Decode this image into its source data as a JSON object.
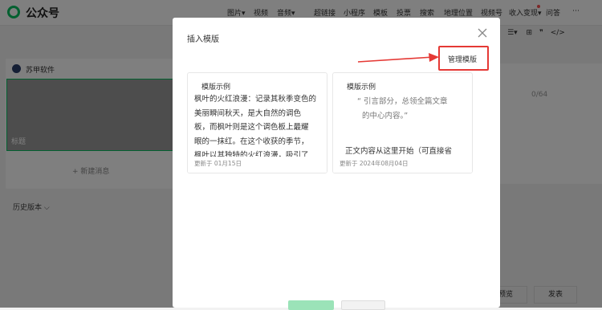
{
  "app": {
    "name": "公众号"
  },
  "topnav": {
    "items": [
      "图片",
      "视频",
      "音频",
      "超链接",
      "小程序",
      "模板",
      "投票",
      "搜索",
      "地理位置",
      "视频号",
      "收入变现",
      "问答"
    ],
    "more": "⋯"
  },
  "editor": {
    "account_name": "苏甲软件",
    "cover_label": "标题",
    "new_message": "+ 新建消息",
    "history": "历史版本",
    "counter": "0/64",
    "preview_button": "预览",
    "publish_button": "发表"
  },
  "modal": {
    "title": "插入模版",
    "manage_button": "管理模版",
    "cards": [
      {
        "title": "模版示例",
        "lines": [
          "枫叶的火红浪漫：记录其秋季变色的",
          "美丽瞬间秋天，是大自然的调色",
          "板，而枫叶则是这个调色板上最耀",
          "眼的一抹红。在这个收获的季节，",
          "枫叶以其独特的火红浪漫，吸引了"
        ],
        "meta": "更新于 01月15日"
      },
      {
        "title": "模版示例",
        "quote": [
          "“ 引言部分，总领全篇文章",
          "的中心内容。”"
        ],
        "partial": "正文内容从这里开始（可直接省",
        "meta": "更新于 2024年08月04日"
      }
    ]
  },
  "colors": {
    "accent": "#07c160",
    "highlight": "#e53935"
  }
}
